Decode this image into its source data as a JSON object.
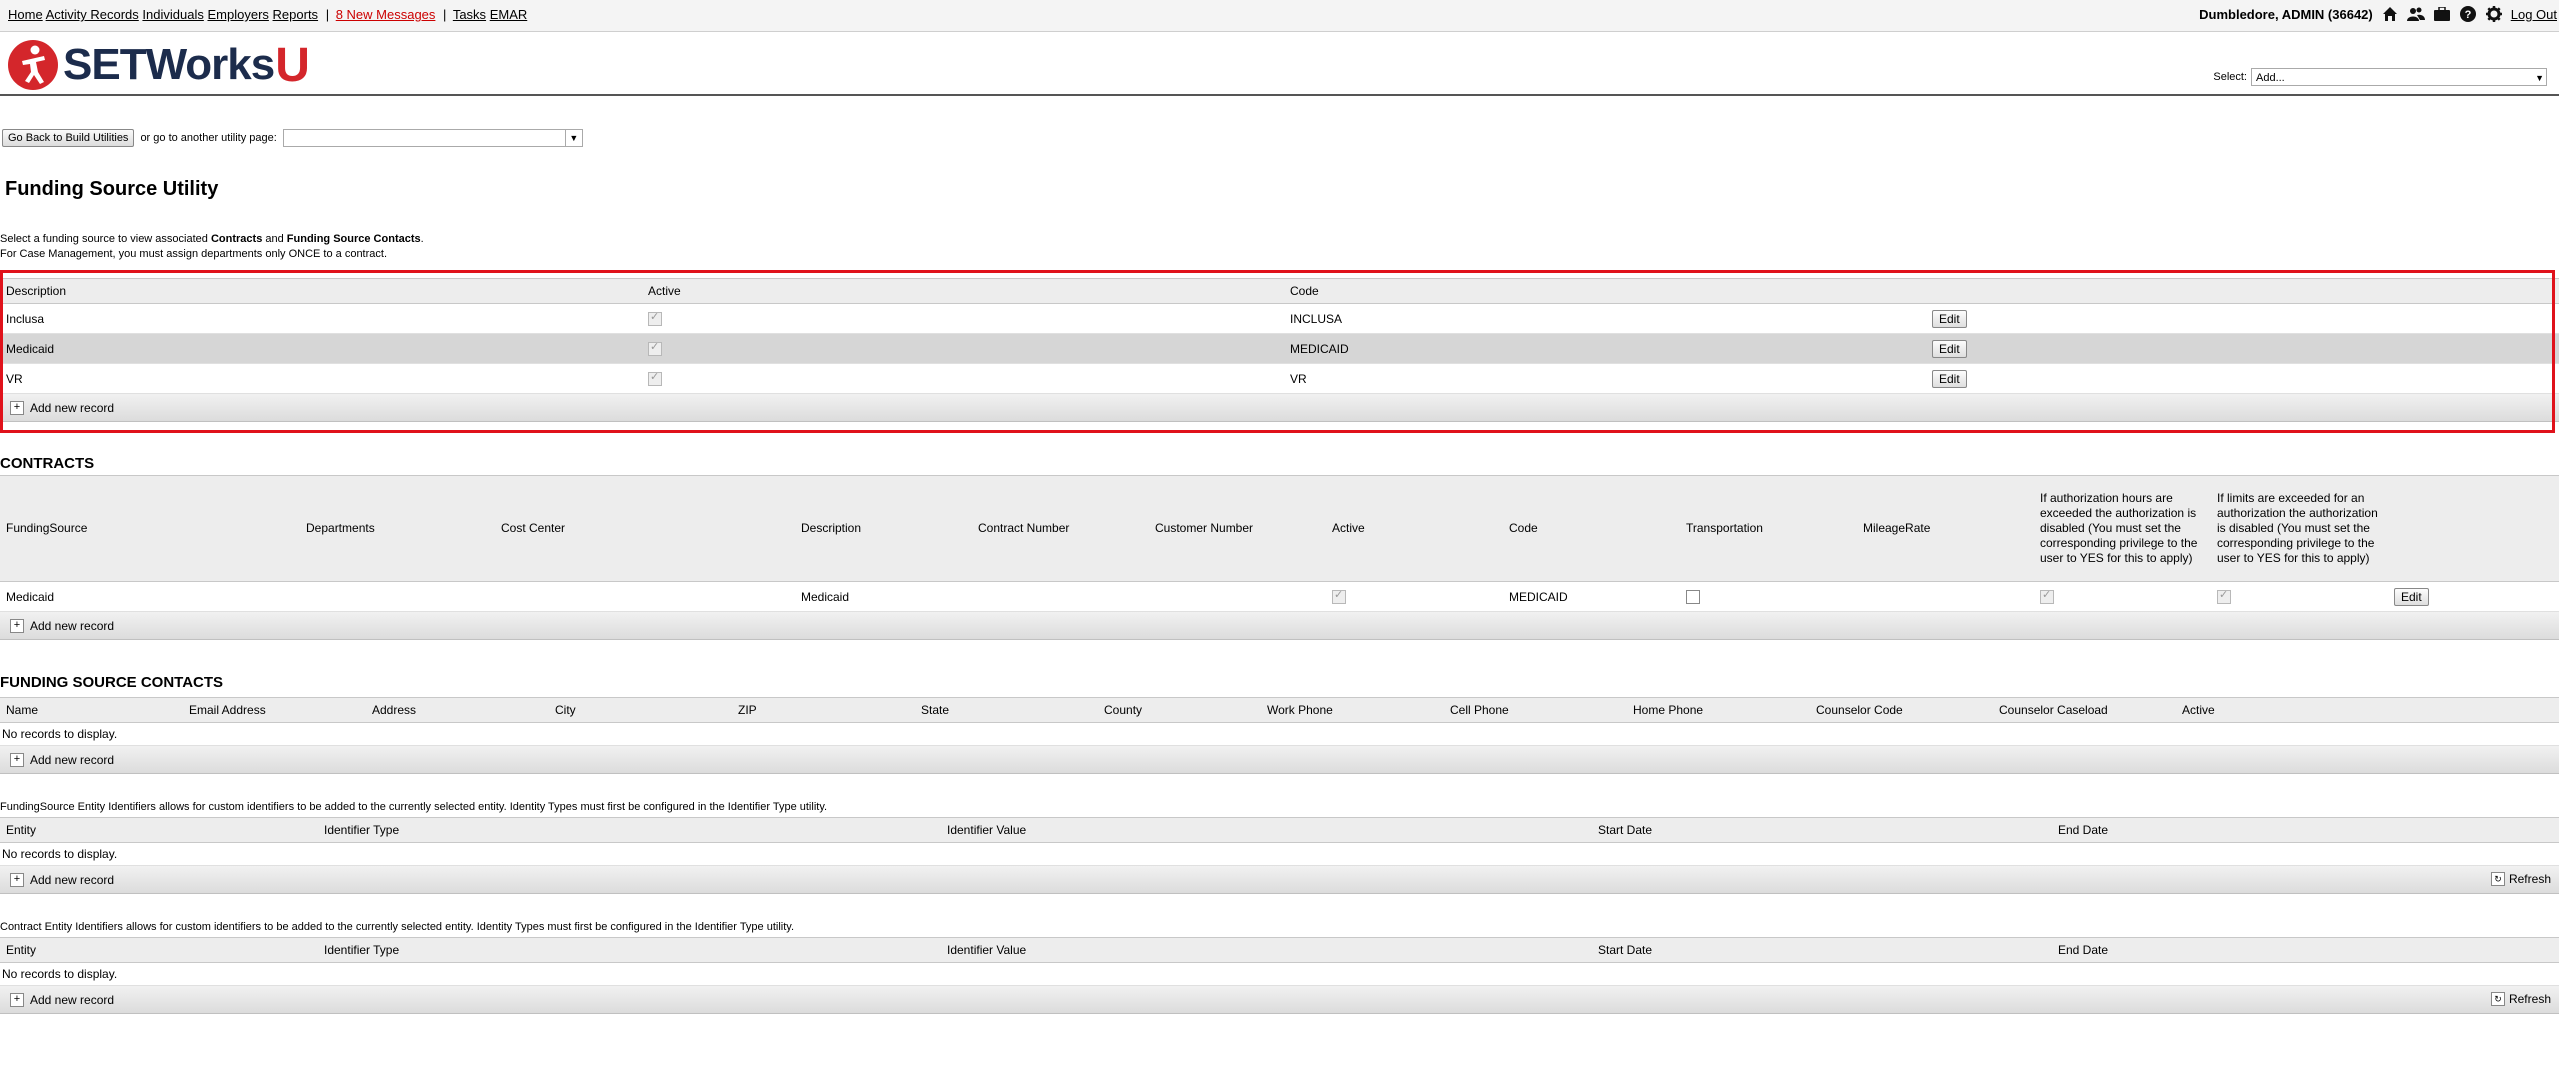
{
  "topnav": {
    "links": [
      "Home",
      "Activity Records",
      "Individuals",
      "Employers",
      "Reports"
    ],
    "messages": "8 New Messages",
    "links2": [
      "Tasks",
      "EMAR"
    ],
    "user": "Dumbledore, ADMIN (36642)",
    "logout": "Log Out"
  },
  "header": {
    "logo_text": "SETWorks",
    "logo_u": "U",
    "select_label": "Select:",
    "select_value": "Add..."
  },
  "utility": {
    "back_button": "Go Back to Build Utilities",
    "goto_label": "or go to another utility page:"
  },
  "page_title": "Funding Source Utility",
  "intro": {
    "line1_a": "Select a funding source to view associated ",
    "line1_b": "Contracts",
    "line1_c": " and ",
    "line1_d": "Funding Source Contacts",
    "line1_e": ".",
    "line2": "For Case Management, you must assign departments only ONCE to a contract."
  },
  "funding_grid": {
    "columns": [
      "Description",
      "Active",
      "Code"
    ],
    "rows": [
      {
        "description": "Inclusa",
        "active": true,
        "code": "INCLUSA",
        "edit": "Edit"
      },
      {
        "description": "Medicaid",
        "active": true,
        "code": "MEDICAID",
        "edit": "Edit"
      },
      {
        "description": "VR",
        "active": true,
        "code": "VR",
        "edit": "Edit"
      }
    ],
    "add_label": "Add new record"
  },
  "contracts": {
    "title": "CONTRACTS",
    "columns": [
      "FundingSource",
      "Departments",
      "Cost Center",
      "Description",
      "Contract Number",
      "Customer Number",
      "Active",
      "Code",
      "Transportation",
      "MileageRate",
      "If authorization hours are exceeded the authorization is disabled (You must set the corresponding privilege to the user to YES for this to apply)",
      "If limits are exceeded for an authorization the authorization is disabled (You must set the corresponding privilege to the user to YES for this to apply)"
    ],
    "row": {
      "funding_source": "Medicaid",
      "description": "Medicaid",
      "code": "MEDICAID",
      "edit": "Edit"
    },
    "add_label": "Add new record"
  },
  "contacts": {
    "title": "FUNDING SOURCE CONTACTS",
    "columns": [
      "Name",
      "Email Address",
      "Address",
      "City",
      "ZIP",
      "State",
      "County",
      "Work Phone",
      "Cell Phone",
      "Home Phone",
      "Counselor Code",
      "Counselor Caseload",
      "Active"
    ],
    "no_records": "No records to display.",
    "add_label": "Add new record"
  },
  "fs_identifiers": {
    "note": "FundingSource Entity Identifiers allows for custom identifiers to be added to the currently selected entity. Identity Types must first be configured in the Identifier Type utility.",
    "columns": [
      "Entity",
      "Identifier Type",
      "Identifier Value",
      "Start Date",
      "End Date"
    ],
    "no_records": "No records to display.",
    "add_label": "Add new record",
    "refresh": "Refresh"
  },
  "contract_identifiers": {
    "note": "Contract Entity Identifiers allows for custom identifiers to be added to the currently selected entity. Identity Types must first be configured in the Identifier Type utility.",
    "columns": [
      "Entity",
      "Identifier Type",
      "Identifier Value",
      "Start Date",
      "End Date"
    ],
    "no_records": "No records to display.",
    "add_label": "Add new record",
    "refresh": "Refresh"
  }
}
